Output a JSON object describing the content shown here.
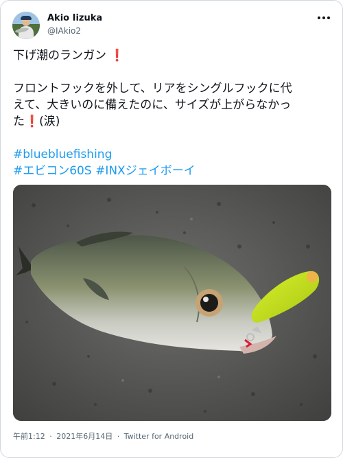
{
  "tweet": {
    "author_name": "Akio Iizuka",
    "author_handle": "@IAkio2",
    "text_line1": "下げ潮のランガン",
    "text_line3": "フロントフックを外して、リアをシングルフックに代",
    "text_line4": "えて、大きいのに備えたのに、サイズが上がらなかっ",
    "text_line5_a": "た",
    "text_line5_b": "(涙)",
    "exclamation": "❗",
    "hashtag1": "#bluebluefishing",
    "hashtag2a": "#エビコン60S",
    "hashtag2b": "#INXジェイボーイ",
    "time": "午前1:12",
    "date": "2021年6月14日",
    "separator": "·",
    "source": "Twitter for Android"
  },
  "colors": {
    "link": "#1d9bf0",
    "text": "#0f1419",
    "secondary": "#536471",
    "exclamation": "#d81b26",
    "lure": "#c8e41c"
  },
  "icons": [
    "more-options-icon",
    "exclamation-icon"
  ]
}
